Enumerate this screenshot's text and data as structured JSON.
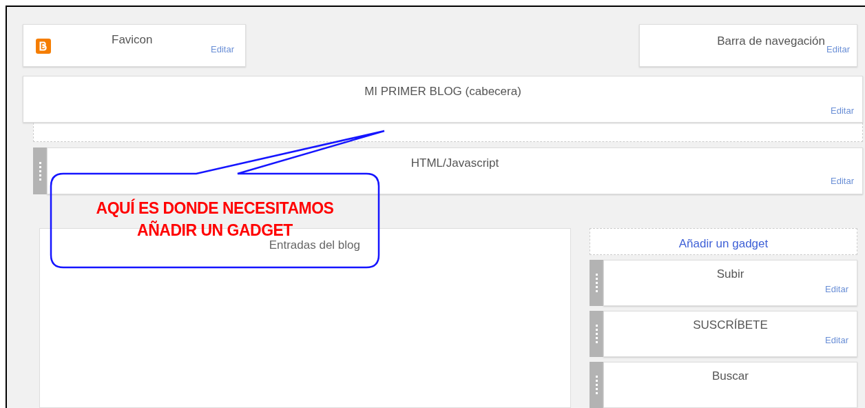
{
  "top_gadgets": [
    {
      "kind": "favicon",
      "title": "Favicon",
      "action": "Editar"
    },
    {
      "kind": "plain",
      "title": "Barra de navegación",
      "action": "Editar"
    }
  ],
  "header": {
    "title": "MI PRIMER BLOG (cabecera)",
    "action": "Editar"
  },
  "html_gadget": {
    "title": "HTML/Javascript",
    "action": "Editar"
  },
  "main": {
    "title": "Entradas del blog"
  },
  "sidebar": {
    "add_link": "Añadir un gadget",
    "gadgets": [
      {
        "title": "Subir",
        "action": "Editar"
      },
      {
        "title": "SUSCRÍBETE",
        "action": "Editar"
      },
      {
        "title": "Buscar"
      }
    ]
  },
  "callout": {
    "lines": [
      "AQUÍ ES DONDE NECESITAMOS",
      "AÑADIR UN GADGET"
    ]
  }
}
